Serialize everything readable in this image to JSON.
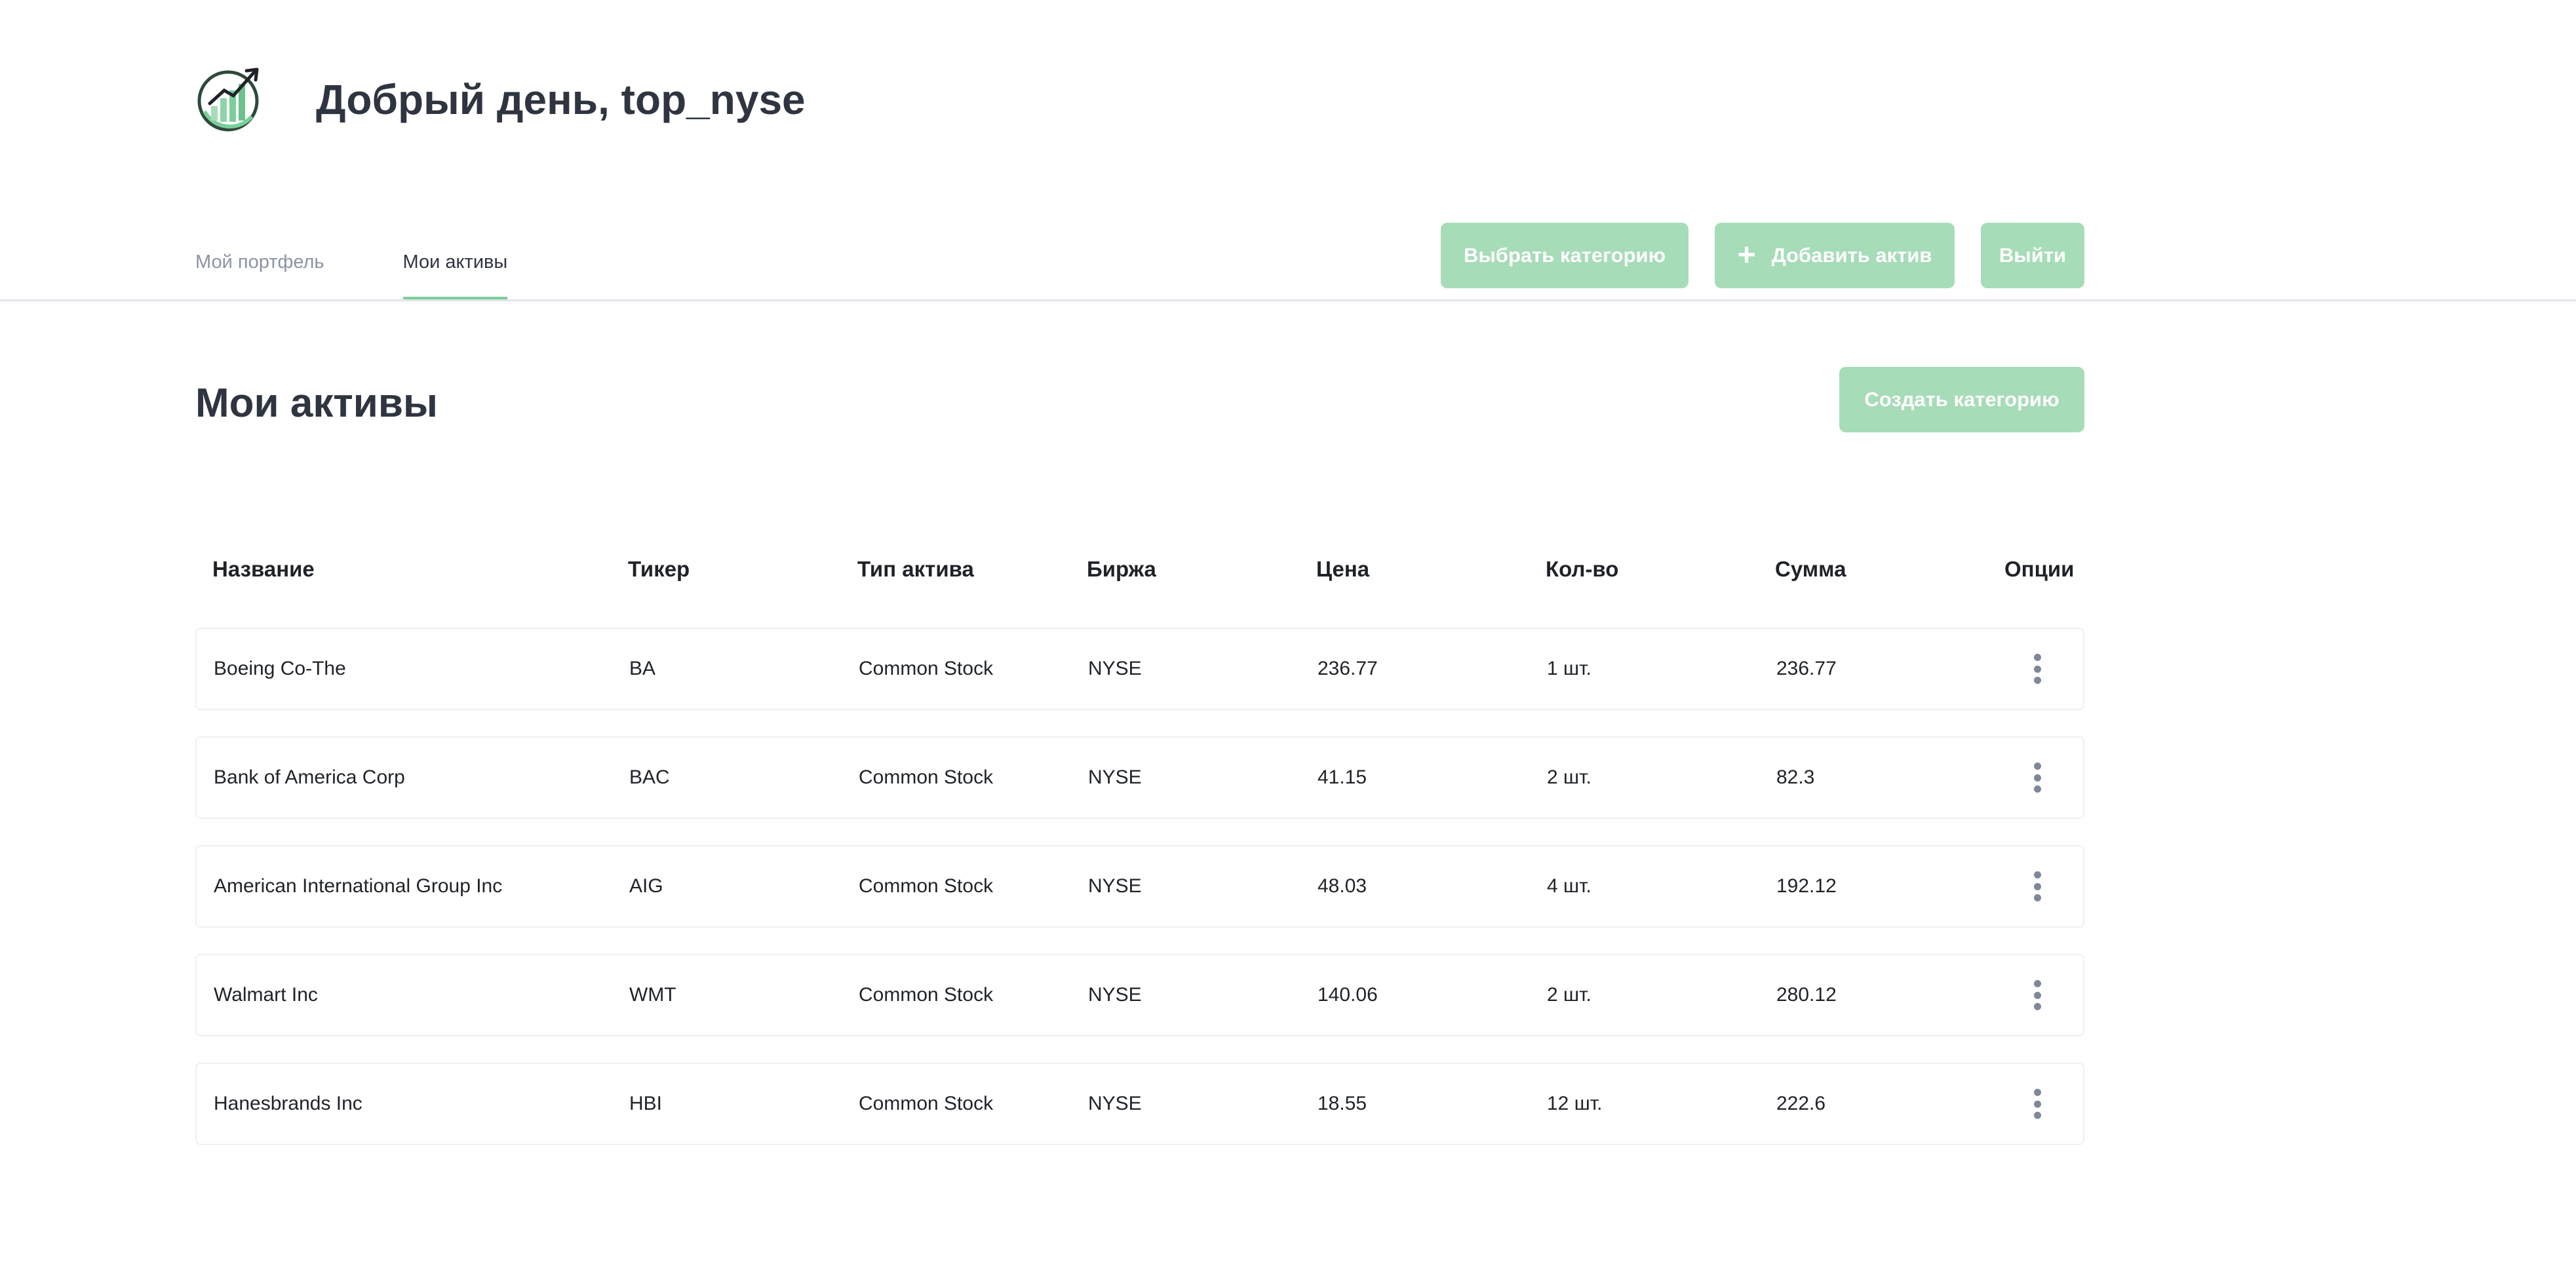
{
  "header": {
    "greeting": "Добрый день, top_nyse"
  },
  "tabs": [
    {
      "label": "Мой портфель",
      "active": false
    },
    {
      "label": "Мои активы",
      "active": true
    }
  ],
  "actions": {
    "choose_category": "Выбрать категорию",
    "add_asset": "Добавить актив",
    "logout": "Выйти",
    "create_category": "Создать категорию"
  },
  "section": {
    "title": "Мои активы"
  },
  "table": {
    "columns": [
      "Название",
      "Тикер",
      "Тип актива",
      "Биржа",
      "Цена",
      "Кол-во",
      "Сумма",
      "Опции"
    ],
    "rows": [
      {
        "name": "Boeing Co-The",
        "ticker": "BA",
        "type": "Common Stock",
        "exchange": "NYSE",
        "price": "236.77",
        "qty": "1 шт.",
        "sum": "236.77"
      },
      {
        "name": "Bank of America Corp",
        "ticker": "BAC",
        "type": "Common Stock",
        "exchange": "NYSE",
        "price": "41.15",
        "qty": "2 шт.",
        "sum": "82.3"
      },
      {
        "name": "American International Group Inc",
        "ticker": "AIG",
        "type": "Common Stock",
        "exchange": "NYSE",
        "price": "48.03",
        "qty": "4 шт.",
        "sum": "192.12"
      },
      {
        "name": "Walmart Inc",
        "ticker": "WMT",
        "type": "Common Stock",
        "exchange": "NYSE",
        "price": "140.06",
        "qty": "2 шт.",
        "sum": "280.12"
      },
      {
        "name": "Hanesbrands Inc",
        "ticker": "HBI",
        "type": "Common Stock",
        "exchange": "NYSE",
        "price": "18.55",
        "qty": "12 шт.",
        "sum": "222.6"
      }
    ]
  },
  "colors": {
    "accent": "#a6dcb8",
    "accent_line": "#7bcf9b",
    "heading": "#2f3540",
    "muted": "#8a94a6"
  },
  "icons": {
    "logo": "growth-chart-logo-icon",
    "add": "plus-icon",
    "options": "kebab-menu-icon"
  }
}
